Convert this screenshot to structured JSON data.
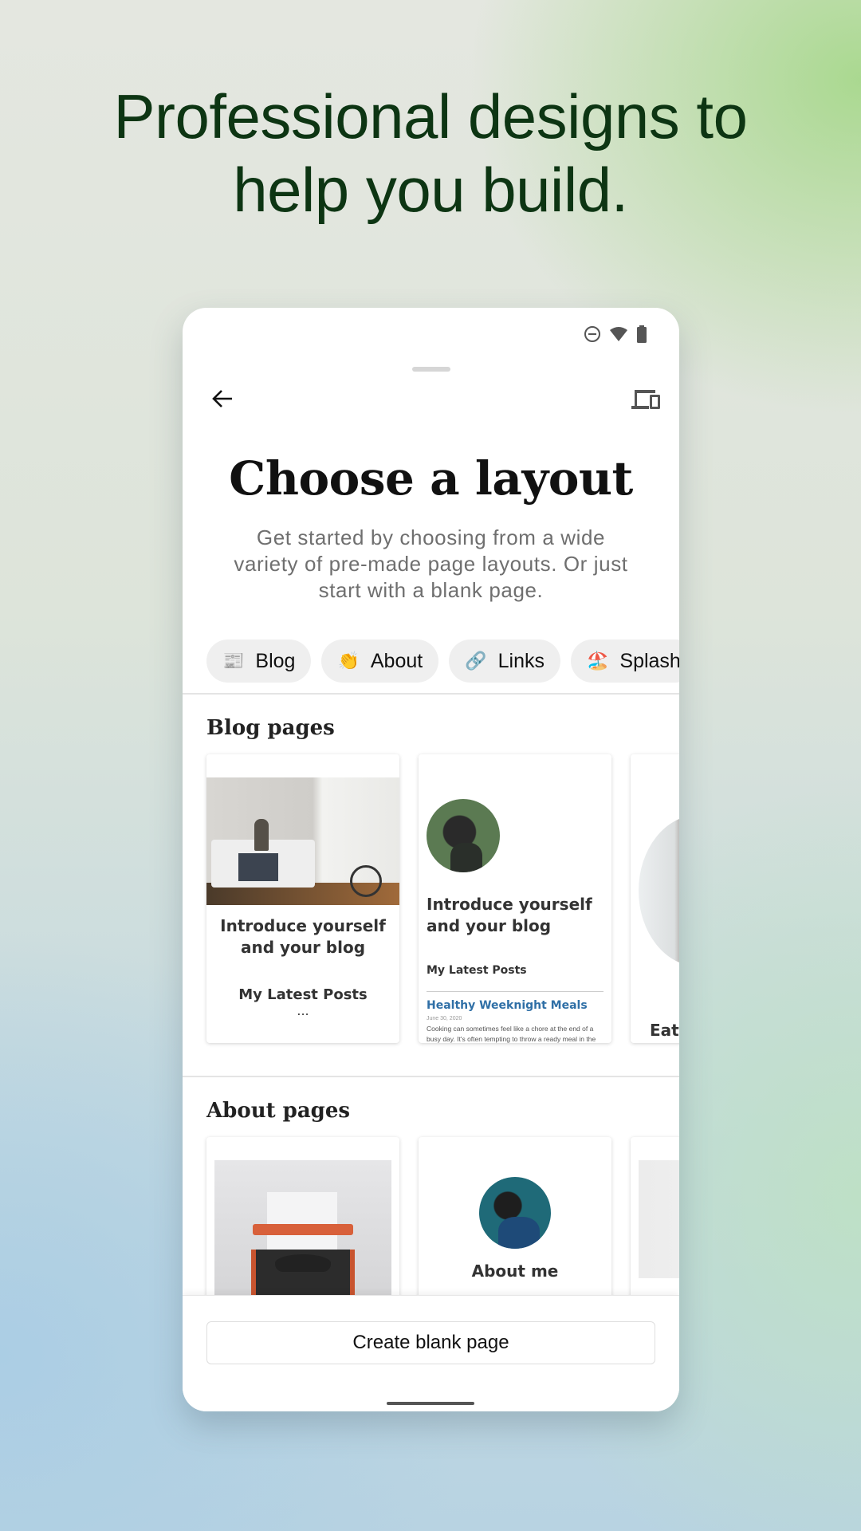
{
  "headline": {
    "line1": "Professional designs to",
    "line2": "help you build."
  },
  "status_bar": {
    "icons": [
      "do-not-disturb-icon",
      "wifi-icon",
      "battery-icon"
    ]
  },
  "toolbar": {
    "back_icon": "arrow-left-icon",
    "preview_icon": "devices-icon"
  },
  "screen": {
    "title": "Choose a layout",
    "subtitle": "Get started by choosing from a wide variety of pre-made page layouts. Or just start with a blank page."
  },
  "chips": [
    {
      "emoji": "📰",
      "label": "Blog"
    },
    {
      "emoji": "👏",
      "label": "About"
    },
    {
      "emoji": "🔗",
      "label": "Links"
    },
    {
      "emoji": "🏖️",
      "label": "Splash"
    }
  ],
  "sections": {
    "blog": {
      "title": "Blog pages",
      "cards": [
        {
          "heading": "Introduce yourself and your blog",
          "subheading": "My Latest Posts",
          "more": "..."
        },
        {
          "heading": "Introduce yourself and your blog",
          "subheading": "My Latest Posts",
          "post_title": "Healthy Weeknight Meals",
          "post_date": "June 30, 2020",
          "post_excerpt": "Cooking can sometimes feel like a chore at the end of a busy day. It's often tempting to throw a ready meal in the"
        },
        {
          "heading": "Eat"
        }
      ]
    },
    "about": {
      "title": "About pages",
      "cards": [
        {
          "heading": ""
        },
        {
          "heading": "About me"
        },
        {
          "heading": ""
        }
      ]
    }
  },
  "footer": {
    "create_blank_label": "Create blank page"
  },
  "colors": {
    "headline": "#0d3513",
    "link_blue": "#2f6fa6",
    "chip_bg": "#efefef"
  }
}
